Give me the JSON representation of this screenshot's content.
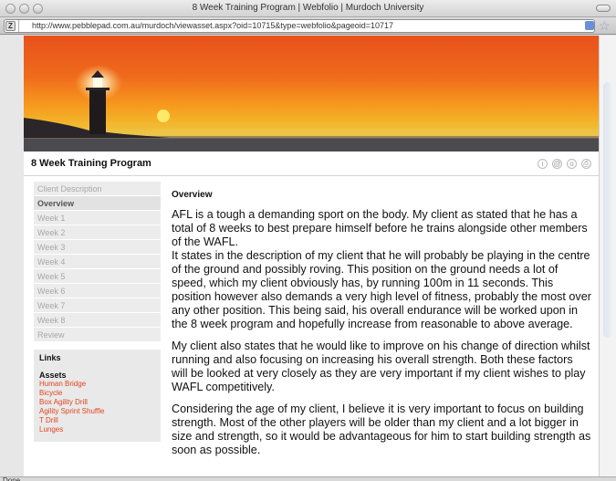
{
  "window": {
    "title": "8 Week Training Program | Webfolio | Murdoch University",
    "url": "http://www.pebblepad.com.au/murdoch/viewasset.aspx?oid=10715&type=webfolio&pageoid=10717"
  },
  "page": {
    "heading": "8 Week Training Program"
  },
  "nav": {
    "items": [
      {
        "label": "Client Description",
        "active": false
      },
      {
        "label": "Overview",
        "active": true
      },
      {
        "label": "Week 1",
        "active": false
      },
      {
        "label": "Week 2",
        "active": false
      },
      {
        "label": "Week 3",
        "active": false
      },
      {
        "label": "Week 4",
        "active": false
      },
      {
        "label": "Week 5",
        "active": false
      },
      {
        "label": "Week 6",
        "active": false
      },
      {
        "label": "Week 7",
        "active": false
      },
      {
        "label": "Week 8",
        "active": false
      },
      {
        "label": "Review",
        "active": false
      }
    ]
  },
  "links": {
    "title": "Links",
    "assets_title": "Assets",
    "assets": [
      "Human Bridge",
      "Bicycle",
      "Box Agility Drill",
      "Agility Sprint Shuffle",
      "T Drill",
      "Lunges"
    ]
  },
  "content": {
    "title": "Overview",
    "paragraphs": [
      "AFL is a tough a demanding sport on the body. My client as stated that he has a total of 8 weeks to best prepare himself before he trains alongside other members of the WAFL.\nIt states in the description of my client that he will probably be playing in the centre of the ground and possibly roving. This position on the ground needs a lot of speed, which my client obviously has, by running 100m in 11 seconds. This position however also demands a very high level of fitness, probably the most over any other position. This being said, his overall endurance will be worked upon in the 8 week program and hopefully increase from reasonable to above average.",
      "My client also states that he would like to improve on his change of direction whilst running and also focusing on increasing his overall strength. Both these factors will be looked at very closely as they are very important if my client wishes to play WAFL competitively.",
      "Considering the age of my client, I believe it is very important to focus on building strength. Most of the other players will be older than my client and a lot bigger in size and strength, so it would be advantageous for him to start building strength as soon as possible."
    ]
  },
  "status": {
    "text": "Done"
  },
  "colors": {
    "link_accent": "#e2451f"
  }
}
